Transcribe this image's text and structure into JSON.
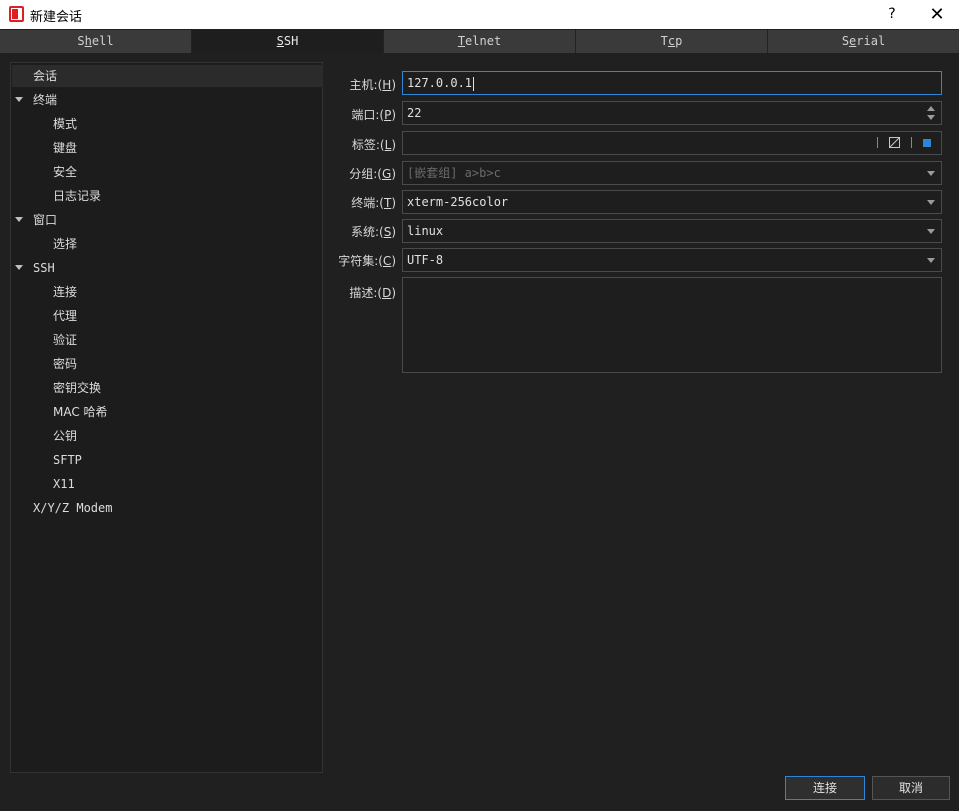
{
  "window": {
    "title": "新建会话",
    "help": "?",
    "close": "✕"
  },
  "tabs": [
    {
      "pre": "S",
      "u": "h",
      "post": "ell",
      "active": false
    },
    {
      "pre": "",
      "u": "S",
      "post": "SH",
      "active": true
    },
    {
      "pre": "",
      "u": "T",
      "post": "elnet",
      "active": false
    },
    {
      "pre": "T",
      "u": "c",
      "post": "p",
      "active": false
    },
    {
      "pre": "S",
      "u": "e",
      "post": "rial",
      "active": false
    }
  ],
  "tree": {
    "items": [
      {
        "label": "会话",
        "level": 0,
        "selected": true
      },
      {
        "label": "终端",
        "level": 0,
        "expandable": true
      },
      {
        "label": "模式",
        "level": 1
      },
      {
        "label": "键盘",
        "level": 1
      },
      {
        "label": "安全",
        "level": 1
      },
      {
        "label": "日志记录",
        "level": 1
      },
      {
        "label": "窗口",
        "level": 0,
        "expandable": true
      },
      {
        "label": "选择",
        "level": 1
      },
      {
        "label": "SSH",
        "level": 0,
        "expandable": true
      },
      {
        "label": "连接",
        "level": 1
      },
      {
        "label": "代理",
        "level": 1
      },
      {
        "label": "验证",
        "level": 1
      },
      {
        "label": "密码",
        "level": 1
      },
      {
        "label": "密钥交换",
        "level": 1
      },
      {
        "label": "MAC 哈希",
        "level": 1
      },
      {
        "label": "公钥",
        "level": 1
      },
      {
        "label": "SFTP",
        "level": 1
      },
      {
        "label": "X11",
        "level": 1
      },
      {
        "label": "X/Y/Z Modem",
        "level": 0
      }
    ]
  },
  "form": {
    "host": {
      "label_pre": "主机:(",
      "key": "H",
      "label_post": ")",
      "value": "127.0.0.1"
    },
    "port": {
      "label_pre": "端口:(",
      "key": "P",
      "label_post": ")",
      "value": "22"
    },
    "tag": {
      "label_pre": "标签:(",
      "key": "L",
      "label_post": ")",
      "value": "",
      "sep": "|"
    },
    "group": {
      "label_pre": "分组:(",
      "key": "G",
      "label_post": ")",
      "placeholder": "[嵌套组] a>b>c"
    },
    "terminal": {
      "label_pre": "终端:(",
      "key": "T",
      "label_post": ")",
      "value": "xterm-256color"
    },
    "system": {
      "label_pre": "系统:(",
      "key": "S",
      "label_post": ")",
      "value": "linux"
    },
    "charset": {
      "label_pre": "字符集:(",
      "key": "C",
      "label_post": ")",
      "value": "UTF-8"
    },
    "description": {
      "label_pre": "描述:(",
      "key": "D",
      "label_post": ")",
      "value": ""
    }
  },
  "buttons": {
    "connect": "连接",
    "cancel": "取消"
  },
  "colors": {
    "accent": "#2e86d6",
    "tag_color": "#2e86d6",
    "logo": "#e02020"
  }
}
